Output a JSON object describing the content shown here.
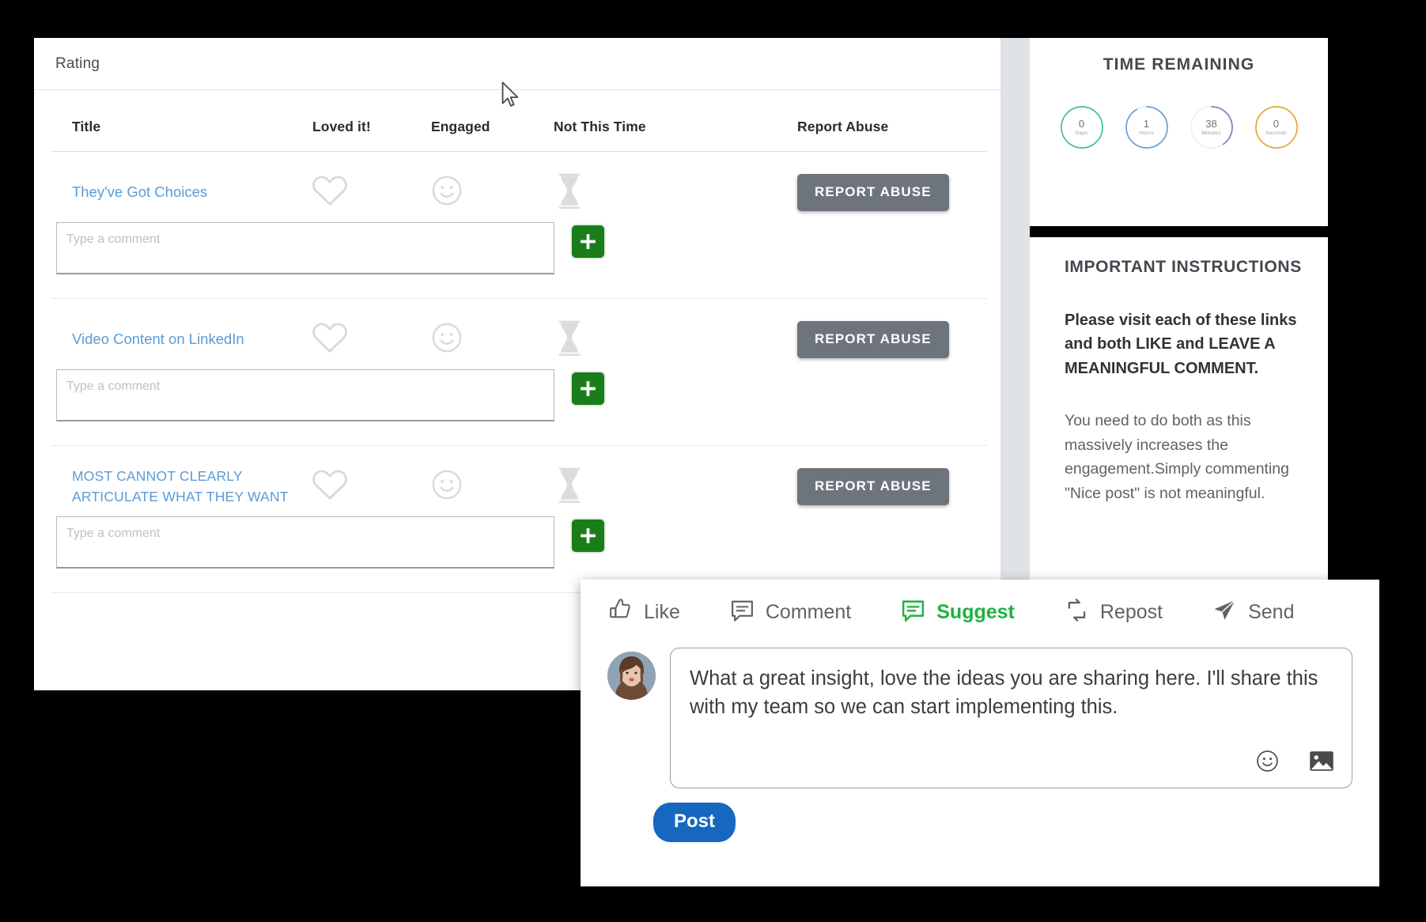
{
  "main_panel": {
    "header_title": "Rating",
    "table": {
      "columns": [
        "Title",
        "Loved it!",
        "Engaged",
        "Not This Time",
        "Report Abuse"
      ],
      "comment_placeholder": "Type a comment",
      "abuse_button_label": "REPORT ABUSE",
      "rows": [
        {
          "title": "They've Got Choices",
          "caps": false
        },
        {
          "title": "Video Content on LinkedIn",
          "caps": false
        },
        {
          "title": "MOST CANNOT CLEARLY ARTICULATE WHAT THEY WANT",
          "caps": true
        }
      ]
    },
    "icons": {
      "loved": "heart-icon",
      "engaged": "smiley-icon",
      "not_this_time": "hourglass-icon",
      "add_comment": "plus-icon"
    }
  },
  "sidebar": {
    "timer": {
      "title": "TIME REMAINING",
      "units": [
        {
          "value": "0",
          "label": "Days",
          "color": "#3fbfa0",
          "pct": 100
        },
        {
          "value": "1",
          "label": "Hours",
          "color": "#6b9fd4",
          "pct": 92
        },
        {
          "value": "38",
          "label": "Minutes",
          "color": "#9b6fc4",
          "pct": 40
        },
        {
          "value": "0",
          "label": "Seconds",
          "color": "#e0a83c",
          "pct": 100
        }
      ]
    },
    "instructions": {
      "heading": "IMPORTANT INSTRUCTIONS",
      "bold_text": "Please visit each of these links and both LIKE and LEAVE A MEANINGFUL COMMENT.",
      "body_text": "You need to do both as this massively increases the engagement.Simply commenting \"Nice post\" is not meaningful."
    }
  },
  "linkedin_popup": {
    "actions": [
      {
        "label": "Like",
        "icon": "thumbs-up-icon",
        "active": false
      },
      {
        "label": "Comment",
        "icon": "speech-bubble-icon",
        "active": false
      },
      {
        "label": "Suggest",
        "icon": "suggest-bubble-icon",
        "active": true
      },
      {
        "label": "Repost",
        "icon": "repost-arrows-icon",
        "active": false
      },
      {
        "label": "Send",
        "icon": "paper-plane-icon",
        "active": false
      }
    ],
    "avatar_alt": "user-avatar",
    "comment_text": "What a great insight, love the ideas you are sharing here. I'll share this with my team so we can start implementing this.",
    "input_icons": [
      "emoji-icon",
      "image-icon"
    ],
    "post_button_label": "Post"
  },
  "colors": {
    "link": "#5b9bd5",
    "abuse_button": "#6e747c",
    "plus_green": "#1a7d19",
    "suggest_green": "#1fb141",
    "post_blue": "#1667c0",
    "background": "#000000"
  },
  "cursor": {
    "name": "mouse-pointer"
  }
}
